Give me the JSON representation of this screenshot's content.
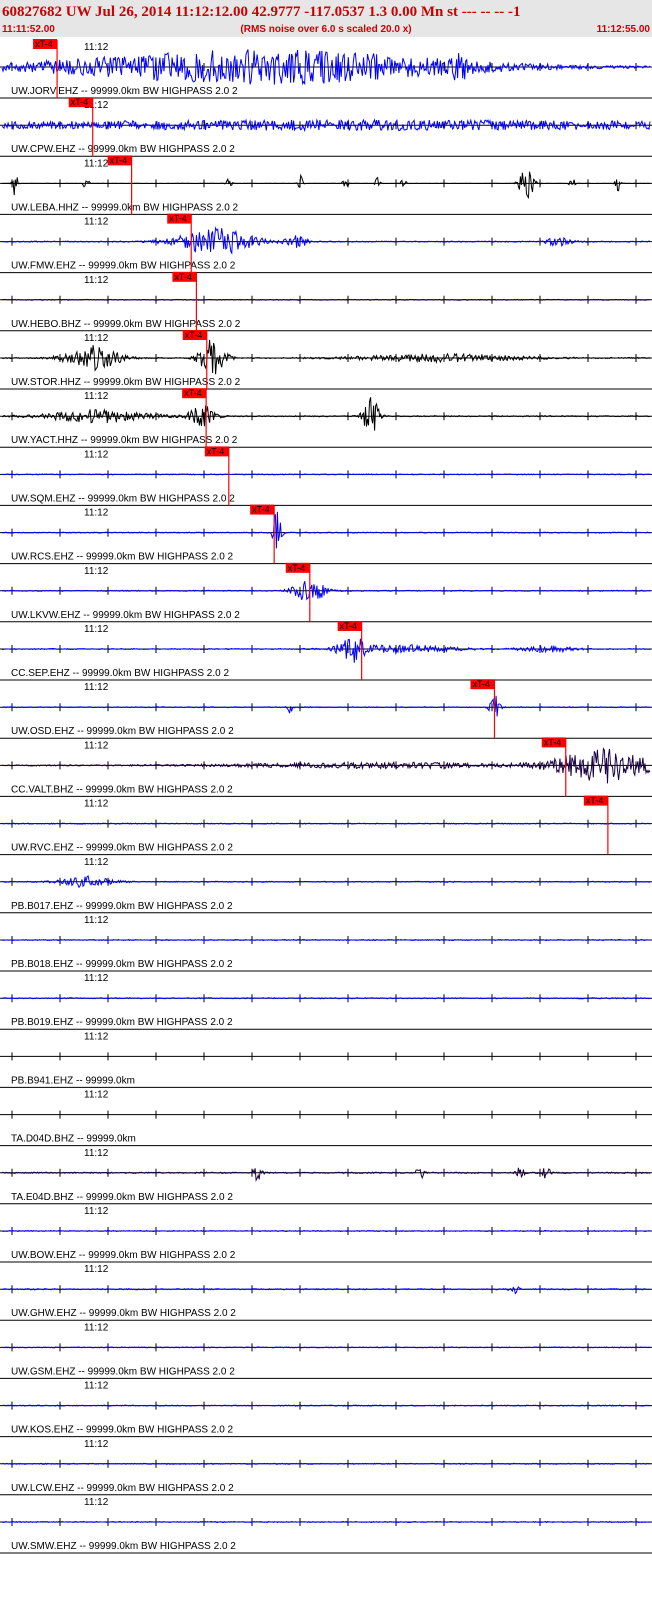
{
  "header": {
    "title": "60827682 UW Jul 26, 2014 11:12:12.00   42.9777 -117.0537  1.3 0.00 Mn st --- -- --  -1",
    "start_time": "11:11:52.00",
    "rms_note": "(RMS noise over 6.0 s scaled 20.0 x)",
    "end_time": "11:12:55.00"
  },
  "colors": {
    "title": "#cc0000",
    "blue_trace": "#0000ff",
    "black_trace": "#000000",
    "dark_trace": "#1a0044",
    "pick": "#ff0000",
    "axis": "#000000"
  },
  "chart_data": {
    "type": "line",
    "title": "60827682 UW Jul 26, 2014 11:12:12.00   42.9777 -117.0537  1.3 0.00 Mn st --- -- --  -1",
    "x_range": [
      "11:11:52.00",
      "11:12:55.00"
    ],
    "x_tick_label": "11:12",
    "pick_label": "xT-4",
    "traces": [
      {
        "label": "UW.JORV.EHZ -- 99999.0km BW  HIGHPASS  2.0  2",
        "color": "#0000ff",
        "noise": 0.22,
        "pick": 0.085,
        "events": [
          {
            "c": 0.4,
            "w": 0.32,
            "a": 8.0
          },
          {
            "c": 0.705,
            "w": 0.012,
            "a": 4.5
          }
        ]
      },
      {
        "label": "UW.CPW.EHZ -- 99999.0km BW  HIGHPASS  2.0  2",
        "color": "#0000ff",
        "noise": 0.25,
        "pick": 0.14,
        "events": [
          {
            "c": 0.55,
            "w": 0.75,
            "a": 2.2
          }
        ]
      },
      {
        "label": "UW.LEBA.HHZ -- 99999.0km BW  HIGHPASS  2.0  2",
        "color": "#000000",
        "noise": 0.05,
        "pick": 0.2,
        "events": [
          {
            "c": 0.02,
            "w": 0.004,
            "a": 6
          },
          {
            "c": 0.13,
            "w": 0.004,
            "a": 5
          },
          {
            "c": 0.35,
            "w": 0.004,
            "a": 4
          },
          {
            "c": 0.46,
            "w": 0.004,
            "a": 4
          },
          {
            "c": 0.53,
            "w": 0.004,
            "a": 3
          },
          {
            "c": 0.58,
            "w": 0.004,
            "a": 3
          },
          {
            "c": 0.62,
            "w": 0.004,
            "a": 3
          },
          {
            "c": 0.81,
            "w": 0.012,
            "a": 7
          },
          {
            "c": 0.88,
            "w": 0.004,
            "a": 3
          },
          {
            "c": 0.95,
            "w": 0.004,
            "a": 4
          }
        ]
      },
      {
        "label": "UW.FMW.EHZ -- 99999.0km BW  HIGHPASS  2.0  2",
        "color": "#0000ff",
        "noise": 0.25,
        "pick": 0.292,
        "events": [
          {
            "c": 0.33,
            "w": 0.06,
            "a": 6
          },
          {
            "c": 0.455,
            "w": 0.015,
            "a": 3
          },
          {
            "c": 0.86,
            "w": 0.02,
            "a": 2
          }
        ]
      },
      {
        "label": "UW.HEBO.BHZ -- 99999.0km BW  HIGHPASS  2.0  2",
        "color": "#1a0044",
        "noise": 0.2,
        "pick": 0.3,
        "events": []
      },
      {
        "label": "UW.STOR.HHZ -- 99999.0km BW  HIGHPASS  2.0  2",
        "color": "#000000",
        "noise": 0.25,
        "pick": 0.316,
        "events": [
          {
            "c": 0.14,
            "w": 0.04,
            "a": 6
          },
          {
            "c": 0.325,
            "w": 0.02,
            "a": 9
          },
          {
            "c": 0.68,
            "w": 0.12,
            "a": 1.8
          }
        ]
      },
      {
        "label": "UW.YACT.HHZ -- 99999.0km BW  HIGHPASS  2.0  2",
        "color": "#000000",
        "noise": 0.25,
        "pick": 0.315,
        "events": [
          {
            "c": 0.15,
            "w": 0.08,
            "a": 3
          },
          {
            "c": 0.31,
            "w": 0.02,
            "a": 5
          },
          {
            "c": 0.57,
            "w": 0.012,
            "a": 9
          }
        ]
      },
      {
        "label": "UW.SQM.EHZ -- 99999.0km BW  HIGHPASS  2.0  2",
        "color": "#0000ff",
        "noise": 0.2,
        "pick": 0.35,
        "events": []
      },
      {
        "label": "UW.RCS.EHZ -- 99999.0km BW  HIGHPASS  2.0  2",
        "color": "#0000ff",
        "noise": 0.22,
        "pick": 0.42,
        "events": [
          {
            "c": 0.425,
            "w": 0.006,
            "a": 12
          }
        ]
      },
      {
        "label": "UW.LKVW.EHZ -- 99999.0km BW  HIGHPASS  2.0  2",
        "color": "#0000ff",
        "noise": 0.22,
        "pick": 0.475,
        "events": [
          {
            "c": 0.475,
            "w": 0.025,
            "a": 5
          }
        ]
      },
      {
        "label": "CC.SEP.EHZ -- 99999.0km BW  HIGHPASS  2.0  2",
        "color": "#0000ff",
        "noise": 0.22,
        "pick": 0.555,
        "events": [
          {
            "c": 0.54,
            "w": 0.02,
            "a": 6
          },
          {
            "c": 0.62,
            "w": 0.08,
            "a": 1.8
          },
          {
            "c": 0.84,
            "w": 0.04,
            "a": 1.6
          }
        ]
      },
      {
        "label": "UW.OSD.EHZ -- 99999.0km BW  HIGHPASS  2.0  2",
        "color": "#0000ff",
        "noise": 0.2,
        "pick": 0.76,
        "events": [
          {
            "c": 0.445,
            "w": 0.004,
            "a": 4
          },
          {
            "c": 0.76,
            "w": 0.008,
            "a": 6
          }
        ]
      },
      {
        "label": "CC.VALT.BHZ -- 99999.0km BW  HIGHPASS  2.0  2",
        "color": "#1a0044",
        "noise": 0.25,
        "pick": 0.87,
        "events": [
          {
            "c": 0.6,
            "w": 0.25,
            "a": 1.2
          },
          {
            "c": 0.93,
            "w": 0.07,
            "a": 8
          }
        ]
      },
      {
        "label": "UW.RVC.EHZ -- 99999.0km BW  HIGHPASS  2.0  2",
        "color": "#0000ff",
        "noise": 0.22,
        "pick": 0.935,
        "events": []
      },
      {
        "label": "PB.B017.EHZ -- 99999.0km BW  HIGHPASS  2.0  2",
        "color": "#0000ff",
        "noise": 0.22,
        "pick": null,
        "events": [
          {
            "c": 0.13,
            "w": 0.04,
            "a": 2.5
          }
        ]
      },
      {
        "label": "PB.B018.EHZ -- 99999.0km BW  HIGHPASS  2.0  2",
        "color": "#0000ff",
        "noise": 0.22,
        "pick": null,
        "events": []
      },
      {
        "label": "PB.B019.EHZ -- 99999.0km BW  HIGHPASS  2.0  2",
        "color": "#0000ff",
        "noise": 0.22,
        "pick": null,
        "events": []
      },
      {
        "label": "PB.B941.EHZ -- 99999.0km",
        "color": "#0000ff",
        "noise": 0,
        "pick": null,
        "events": []
      },
      {
        "label": "TA.D04D.BHZ -- 99999.0km",
        "color": "#0000ff",
        "noise": 0,
        "pick": null,
        "events": []
      },
      {
        "label": "TA.E04D.BHZ -- 99999.0km BW  HIGHPASS  2.0  2",
        "color": "#1a0044",
        "noise": 0.3,
        "pick": null,
        "events": [
          {
            "c": 0.395,
            "w": 0.006,
            "a": 4
          },
          {
            "c": 0.645,
            "w": 0.006,
            "a": 4
          },
          {
            "c": 0.8,
            "w": 0.006,
            "a": 3
          },
          {
            "c": 0.84,
            "w": 0.006,
            "a": 3
          }
        ]
      },
      {
        "label": "UW.BOW.EHZ -- 99999.0km BW  HIGHPASS  2.0  2",
        "color": "#0000ff",
        "noise": 0.22,
        "pick": null,
        "events": []
      },
      {
        "label": "UW.GHW.EHZ -- 99999.0km BW  HIGHPASS  2.0  2",
        "color": "#0000ff",
        "noise": 0.25,
        "pick": null,
        "events": [
          {
            "c": 0.79,
            "w": 0.006,
            "a": 3
          }
        ]
      },
      {
        "label": "UW.GSM.EHZ -- 99999.0km BW  HIGHPASS  2.0  2",
        "color": "#0000ff",
        "noise": 0.2,
        "pick": null,
        "events": []
      },
      {
        "label": "UW.KOS.EHZ -- 99999.0km BW  HIGHPASS  2.0  2",
        "color": "#0000ff",
        "noise": 0.22,
        "pick": null,
        "events": []
      },
      {
        "label": "UW.LCW.EHZ -- 99999.0km BW  HIGHPASS  2.0  2",
        "color": "#0000ff",
        "noise": 0.22,
        "pick": null,
        "events": []
      },
      {
        "label": "UW.SMW.EHZ -- 99999.0km BW  HIGHPASS  2.0  2",
        "color": "#0000ff",
        "noise": 0.22,
        "pick": null,
        "events": []
      }
    ]
  }
}
